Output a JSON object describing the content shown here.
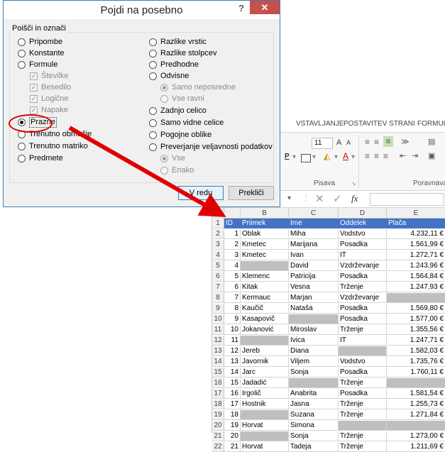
{
  "dialog": {
    "title": "Pojdi na posebno",
    "help": "?",
    "close": "✕",
    "group_title": "Poišči in označi",
    "left_options": [
      {
        "label": "Pripombe"
      },
      {
        "label": "Konstante"
      },
      {
        "label": "Formule"
      },
      {
        "label": "Številke"
      },
      {
        "label": "Besedilo"
      },
      {
        "label": "Logične"
      },
      {
        "label": "Napake"
      },
      {
        "label": "Prazne"
      },
      {
        "label": "Trenutno območje"
      },
      {
        "label": "Trenutno matriko"
      },
      {
        "label": "Predmete"
      }
    ],
    "right_options": [
      {
        "label": "Razlike vrstic"
      },
      {
        "label": "Razlike stolpcev"
      },
      {
        "label": "Predhodne"
      },
      {
        "label": "Odvisne"
      },
      {
        "label": "Samo neposredne"
      },
      {
        "label": "Vse ravni"
      },
      {
        "label": "Zadnjo celico"
      },
      {
        "label": "Samo vidne celice"
      },
      {
        "label": "Pogojne oblike"
      },
      {
        "label": "Preverjanje veljavnosti podatkov"
      },
      {
        "label": "Vse"
      },
      {
        "label": "Enako"
      }
    ],
    "ok_label": "V redu",
    "cancel_label": "Prekliči"
  },
  "excel": {
    "tabs": [
      "VSTAVLJANJE",
      "POSTAVITEV STRANI",
      "FORMUL"
    ],
    "font_size": "11",
    "grow_font": "A",
    "shrink_font": "A",
    "group_font": "Pisava",
    "group_align": "Poravnava",
    "formula_symbol": "fx",
    "columns": [
      "B",
      "C",
      "D",
      "E"
    ],
    "header_row": {
      "num": "1",
      "cells": [
        "ID",
        "Priimek",
        "Ime",
        "Oddelek",
        "Plača"
      ]
    },
    "rows": [
      {
        "num": "2",
        "id": "1",
        "priimek": "Oblak",
        "ime": "Miha",
        "oddelek": "Vodstvo",
        "placa": "4.232,11 €"
      },
      {
        "num": "3",
        "id": "2",
        "priimek": "Kmetec",
        "ime": "Marijana",
        "oddelek": "Posadka",
        "placa": "1.561,99 €"
      },
      {
        "num": "4",
        "id": "3",
        "priimek": "Kmetec",
        "ime": "Ivan",
        "oddelek": "IT",
        "placa": "1.272,71 €"
      },
      {
        "num": "5",
        "id": "4",
        "priimek": "",
        "ime": "David",
        "oddelek": "Vzdrževanje",
        "placa": "1.243,96 €"
      },
      {
        "num": "6",
        "id": "5",
        "priimek": "Klemenc",
        "ime": "Patricija",
        "oddelek": "Posadka",
        "placa": "1.564,84 €"
      },
      {
        "num": "7",
        "id": "6",
        "priimek": "Kitak",
        "ime": "Vesna",
        "oddelek": "Trženje",
        "placa": "1.247,93 €"
      },
      {
        "num": "8",
        "id": "7",
        "priimek": "Kermauc",
        "ime": "Marjan",
        "oddelek": "Vzdrževanje",
        "placa": ""
      },
      {
        "num": "9",
        "id": "8",
        "priimek": "Kaučič",
        "ime": "Nataša",
        "oddelek": "Posadka",
        "placa": "1.569,80 €"
      },
      {
        "num": "10",
        "id": "9",
        "priimek": "Kasapovič",
        "ime": "",
        "oddelek": "Posadka",
        "placa": "1.577,00 €"
      },
      {
        "num": "11",
        "id": "10",
        "priimek": "Jokanović",
        "ime": "Miroslav",
        "oddelek": "Trženje",
        "placa": "1.355,56 €"
      },
      {
        "num": "12",
        "id": "11",
        "priimek": "",
        "ime": "Ivica",
        "oddelek": "IT",
        "placa": "1.247,71 €"
      },
      {
        "num": "13",
        "id": "12",
        "priimek": "Jereb",
        "ime": "Diana",
        "oddelek": "",
        "placa": "1.582,03 €"
      },
      {
        "num": "14",
        "id": "13",
        "priimek": "Javornik",
        "ime": "Viljem",
        "oddelek": "Vodstvo",
        "placa": "1.735,76 €"
      },
      {
        "num": "15",
        "id": "14",
        "priimek": "Jarc",
        "ime": "Sonja",
        "oddelek": "Posadka",
        "placa": "1.760,11 €"
      },
      {
        "num": "16",
        "id": "15",
        "priimek": "Jadadić",
        "ime": "",
        "oddelek": "Trženje",
        "placa": ""
      },
      {
        "num": "17",
        "id": "16",
        "priimek": "Irgolič",
        "ime": "Anabrita",
        "oddelek": "Posadka",
        "placa": "1.581,54 €"
      },
      {
        "num": "18",
        "id": "17",
        "priimek": "Hostnik",
        "ime": "Jasna",
        "oddelek": "Trženje",
        "placa": "1.255,73 €"
      },
      {
        "num": "19",
        "id": "18",
        "priimek": "",
        "ime": "Suzana",
        "oddelek": "Trženje",
        "placa": "1.271,84 €"
      },
      {
        "num": "20",
        "id": "19",
        "priimek": "Horvat",
        "ime": "Simona",
        "oddelek": "",
        "placa": ""
      },
      {
        "num": "21",
        "id": "20",
        "priimek": "",
        "ime": "Sonja",
        "oddelek": "Trženje",
        "placa": "1.273,00 €"
      },
      {
        "num": "22",
        "id": "21",
        "priimek": "Horvat",
        "ime": "Tadeja",
        "oddelek": "Trženje",
        "placa": "1.211,69 €"
      }
    ]
  },
  "colors": {
    "header_blue": "#4472c4",
    "blank_gray": "#bfbfbf",
    "highlight_red": "#e00000",
    "close_red": "#c7504c"
  }
}
